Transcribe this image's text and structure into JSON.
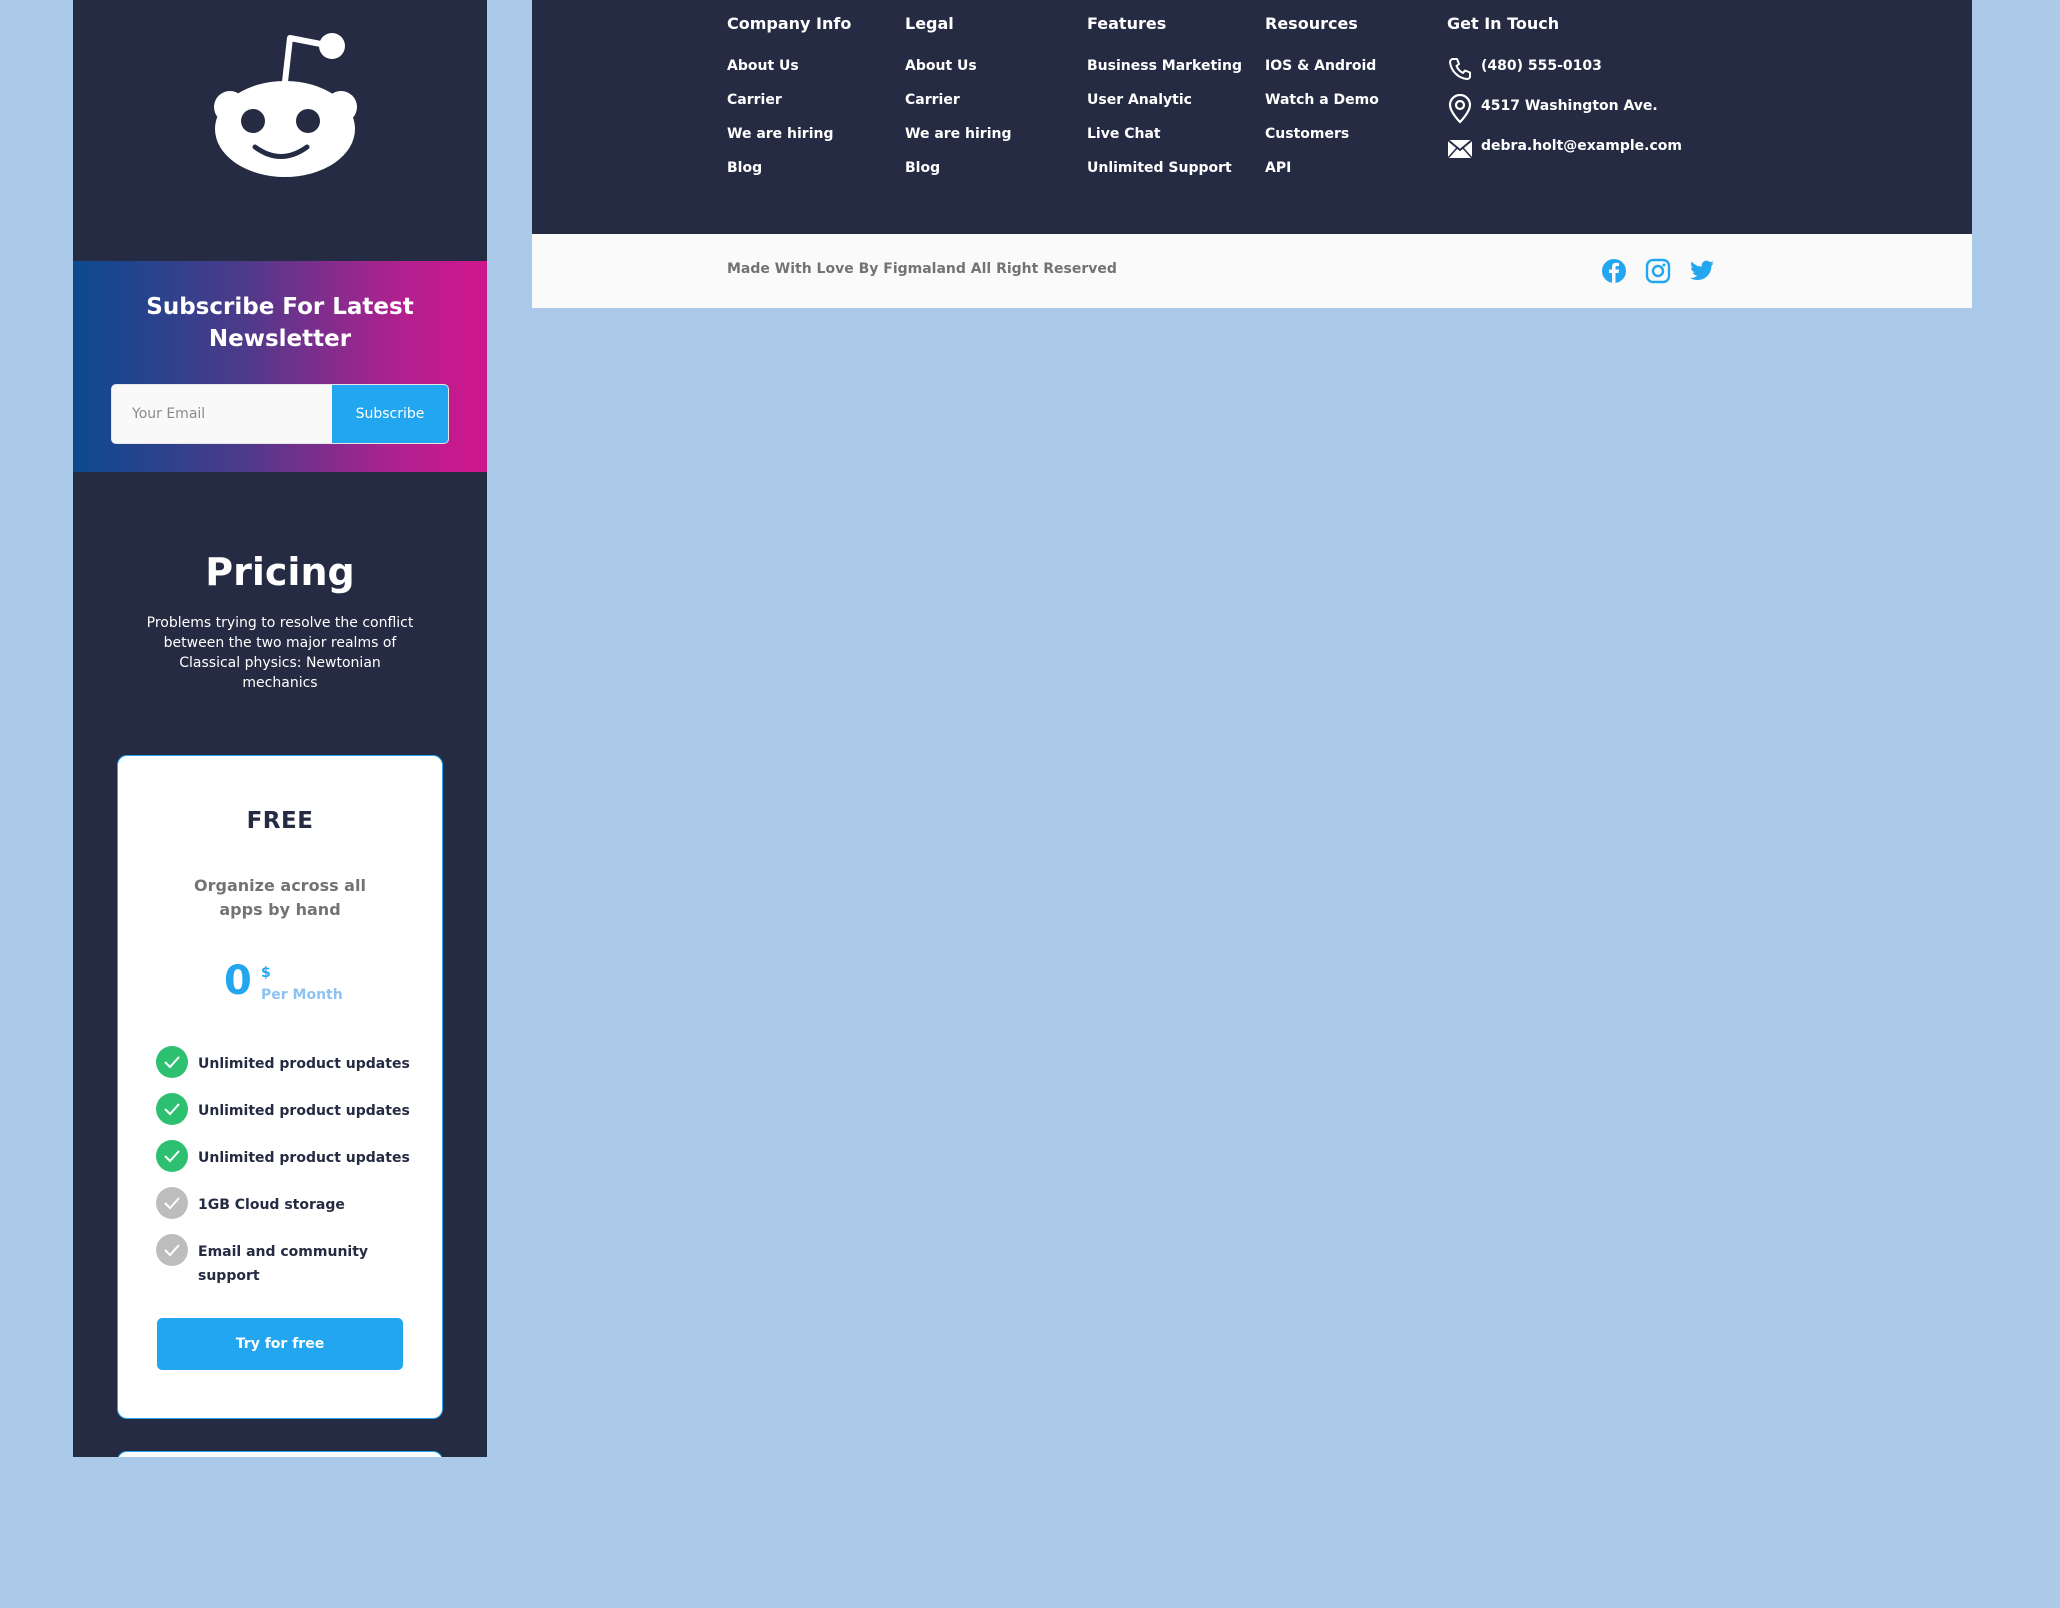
{
  "newsletter": {
    "title": "Subscribe For Latest Newsletter",
    "email_placeholder": "Your Email",
    "subscribe_label": "Subscribe"
  },
  "pricing": {
    "title": "Pricing",
    "description": "Problems trying to resolve the conflict between the two major realms of Classical physics: Newtonian mechanics"
  },
  "plan": {
    "name": "FREE",
    "tagline": "Organize across all apps by hand",
    "price": "0",
    "currency": "$",
    "period": "Per Month",
    "features": [
      {
        "text": "Unlimited product updates",
        "included": true
      },
      {
        "text": "Unlimited product updates",
        "included": true
      },
      {
        "text": "Unlimited product updates",
        "included": true
      },
      {
        "text": "1GB  Cloud storage",
        "included": false
      },
      {
        "text": "Email and community support",
        "included": false
      }
    ],
    "cta_label": "Try for free"
  },
  "footer": {
    "columns": [
      {
        "title": "Company Info",
        "links": [
          "About Us",
          "Carrier",
          "We are hiring",
          "Blog"
        ]
      },
      {
        "title": "Legal",
        "links": [
          "About Us",
          "Carrier",
          "We are hiring",
          "Blog"
        ]
      },
      {
        "title": "Features",
        "links": [
          "Business Marketing",
          "User Analytic",
          "Live Chat",
          "Unlimited Support"
        ]
      },
      {
        "title": "Resources",
        "links": [
          "IOS & Android",
          "Watch a Demo",
          "Customers",
          "API"
        ]
      }
    ],
    "contact": {
      "title": "Get In Touch",
      "phone": "(480) 555-0103",
      "address": "4517 Washington Ave.",
      "email": "debra.holt@example.com"
    },
    "copyright": "Made With Love By Figmaland All Right Reserved",
    "social": [
      "facebook-icon",
      "instagram-icon",
      "twitter-icon"
    ]
  },
  "colors": {
    "background": "#abcae9",
    "dark": "#252b42",
    "accent": "#23a6f0",
    "success": "#2dc071",
    "muted": "#bdbdbd"
  }
}
